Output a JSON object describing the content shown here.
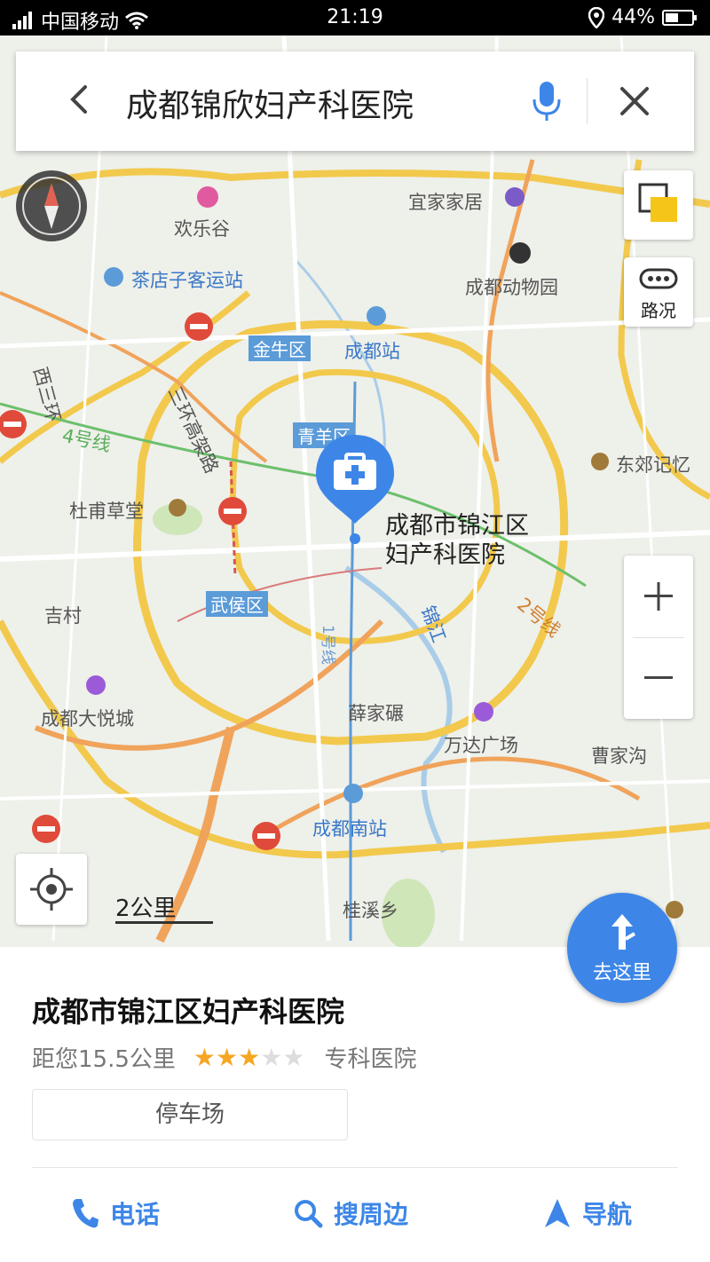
{
  "status_bar": {
    "carrier": "中国移动",
    "time": "21:19",
    "battery": "44%"
  },
  "search": {
    "query": "成都锦欣妇产科医院"
  },
  "map_controls": {
    "traffic_label": "路况",
    "scale_label": "2公里",
    "goto_label": "去这里"
  },
  "map_labels": {
    "huanlegu": "欢乐谷",
    "yijiajiaju": "宜家家居",
    "chadianzi": "茶店子客运站",
    "zoo": "成都动物园",
    "jinniu": "金牛区",
    "chengdu_station": "成都站",
    "xisanhuan": "西三环",
    "sanhuan_gaojia": "三环高架路",
    "line4": "4号线",
    "qingyang": "青羊区",
    "dongjiao": "东郊记忆",
    "dufu": "杜甫草堂",
    "wuhou": "武侯区",
    "jicun": "吉村",
    "jinjiang_river": "锦江",
    "line2": "2号线",
    "line1": "1号线",
    "dayuecheng": "成都大悦城",
    "xuejiazui": "薛家碾",
    "wanda": "万达广场",
    "caojiagou": "曹家沟",
    "south_station": "成都南站",
    "guixixiang": "桂溪乡"
  },
  "pin": {
    "line1": "成都市锦江区",
    "line2": "妇产科医院"
  },
  "poi": {
    "name": "成都市锦江区妇产科医院",
    "distance": "距您15.5公里",
    "rating": 3,
    "rating_max": 5,
    "category": "专科医院",
    "tag": "停车场"
  },
  "actions": [
    {
      "label": "电话",
      "icon": "phone-icon"
    },
    {
      "label": "搜周边",
      "icon": "search-icon"
    },
    {
      "label": "导航",
      "icon": "navigation-arrow-icon"
    }
  ],
  "colors": {
    "accent": "#3d86e8",
    "star_on": "#f5a623",
    "star_off": "#dddddd",
    "road_yellow": "#f2c94c",
    "road_orange": "#f0a35a"
  }
}
